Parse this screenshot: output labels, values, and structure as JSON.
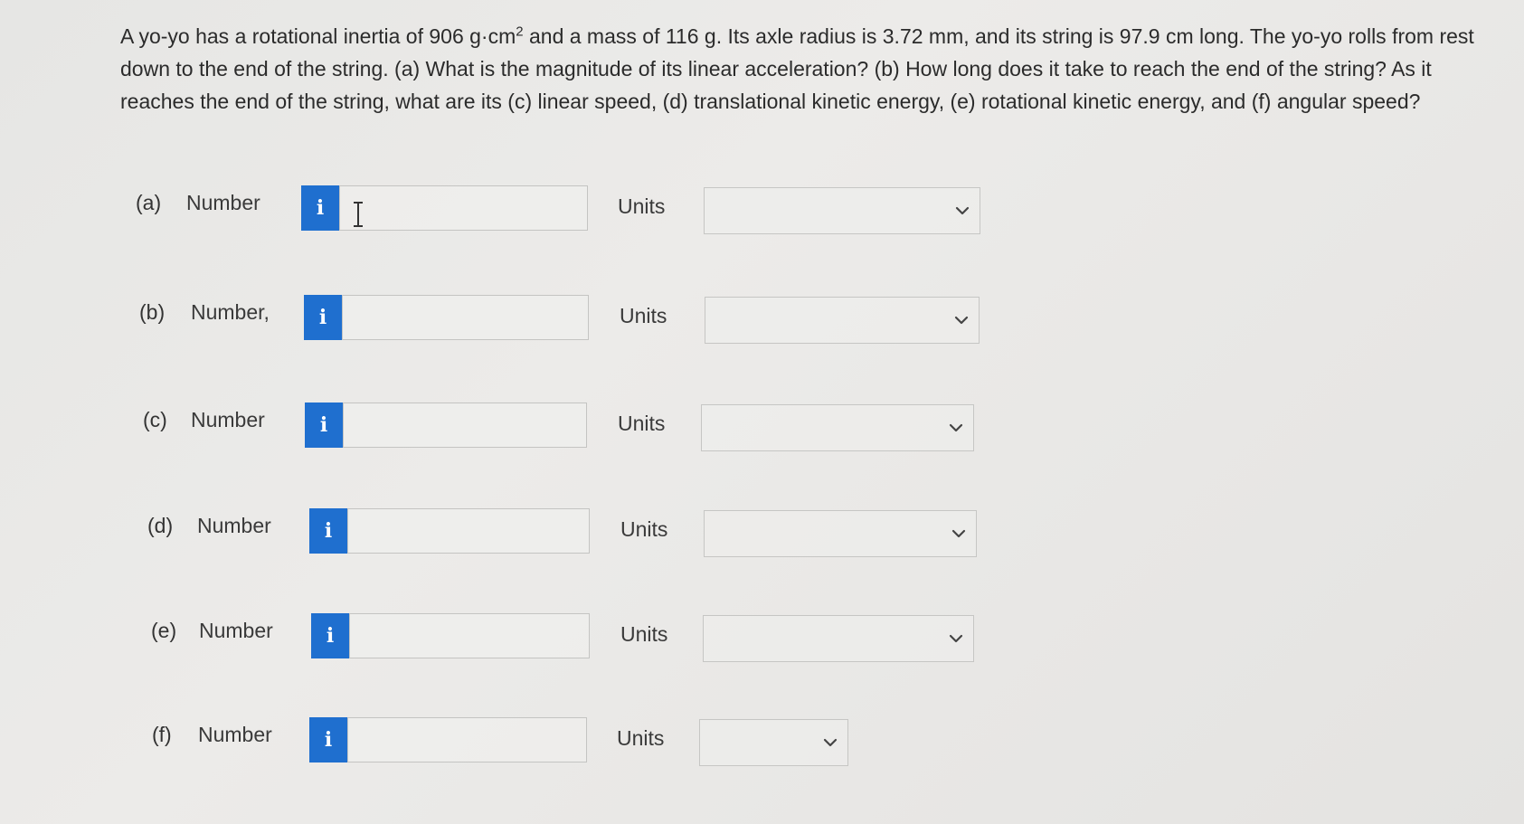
{
  "question": {
    "p1": "A yo-yo has a rotational inertia of 906 g·cm",
    "sup": "2",
    "p2": " and a mass of 116 g. Its axle radius is 3.72 mm, and its string is 97.9 cm long. The yo-yo rolls from rest down to the end of the string. (a) What is the magnitude of its linear acceleration? (b) How long does it take to reach the end of the string? As it reaches the end of the string, what are its (c) linear speed, (d) translational kinetic energy, (e) rotational kinetic energy, and (f) angular speed?"
  },
  "parts": [
    {
      "label": "(a)",
      "number_label": "Number",
      "info": "i",
      "value": "",
      "units_label": "Units",
      "units_value": ""
    },
    {
      "label": "(b)",
      "number_label": "Number,",
      "info": "i",
      "value": "",
      "units_label": "Units",
      "units_value": ""
    },
    {
      "label": "(c)",
      "number_label": "Number",
      "info": "i",
      "value": "",
      "units_label": "Units",
      "units_value": ""
    },
    {
      "label": "(d)",
      "number_label": "Number",
      "info": "i",
      "value": "",
      "units_label": "Units",
      "units_value": ""
    },
    {
      "label": "(e)",
      "number_label": "Number",
      "info": "i",
      "value": "",
      "units_label": "Units",
      "units_value": ""
    },
    {
      "label": "(f)",
      "number_label": "Number",
      "info": "i",
      "value": "",
      "units_label": "Units",
      "units_value": ""
    }
  ],
  "colors": {
    "info_button": "#1f6fcf",
    "background": "#e8e8e6"
  },
  "icons": {
    "info": "info-icon",
    "dropdown": "chevron-down-icon",
    "cursor": "text-cursor-icon"
  }
}
